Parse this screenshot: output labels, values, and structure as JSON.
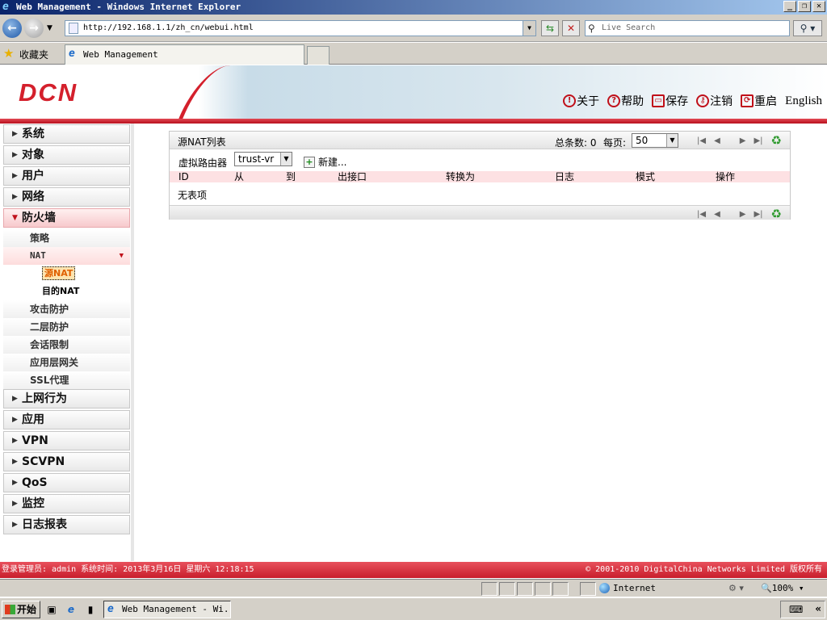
{
  "window": {
    "title": "Web Management - Windows Internet Explorer",
    "controls": [
      "_",
      "❐",
      "✕"
    ]
  },
  "browser": {
    "address": "http://192.168.1.1/zh_cn/webui.html",
    "search_placeholder": "Live Search",
    "favorites_label": "收藏夹",
    "tab_title": "Web Management",
    "status_zone": "Internet",
    "zoom": "100%"
  },
  "app": {
    "logo": "DCN",
    "top_menu": [
      {
        "label": "关于",
        "icon": "info-icon"
      },
      {
        "label": "帮助",
        "icon": "help-icon"
      },
      {
        "label": "保存",
        "icon": "save-icon"
      },
      {
        "label": "注销",
        "icon": "logout-key-icon"
      },
      {
        "label": "重启",
        "icon": "reboot-icon"
      }
    ],
    "english": "English",
    "accent_color": "#d4202c"
  },
  "sidebar": {
    "menu_top": [
      "系统",
      "对象",
      "用户",
      "网络"
    ],
    "firewall": "防火墙",
    "firewall_sub": {
      "policy": "策略",
      "nat": "NAT",
      "snat": "源NAT",
      "dnat": "目的NAT",
      "attack": "攻击防护",
      "l2": "二层防护",
      "session": "会话限制",
      "alg": "应用层网关",
      "ssl": "SSL代理"
    },
    "menu_bottom": [
      "上网行为",
      "应用",
      "VPN",
      "SCVPN",
      "QoS",
      "监控",
      "日志报表"
    ]
  },
  "panel": {
    "title": "源NAT列表",
    "total_label": "总条数: 0",
    "per_page_label": "每页:",
    "per_page_value": "50",
    "vr_label": "虚拟路由器",
    "vr_value": "trust-vr",
    "new_label": "新建...",
    "columns": [
      "ID",
      "从",
      "到",
      "出接口",
      "转换为",
      "日志",
      "模式",
      "操作"
    ],
    "empty": "无表项"
  },
  "footer": {
    "login_info": "登录管理员: admin 系统时间: 2013年3月16日 星期六 12:18:15",
    "copyright": "© 2001-2010 DigitalChina Networks Limited 版权所有"
  },
  "taskbar": {
    "start": "开始",
    "task": "Web Management - Wi..."
  }
}
